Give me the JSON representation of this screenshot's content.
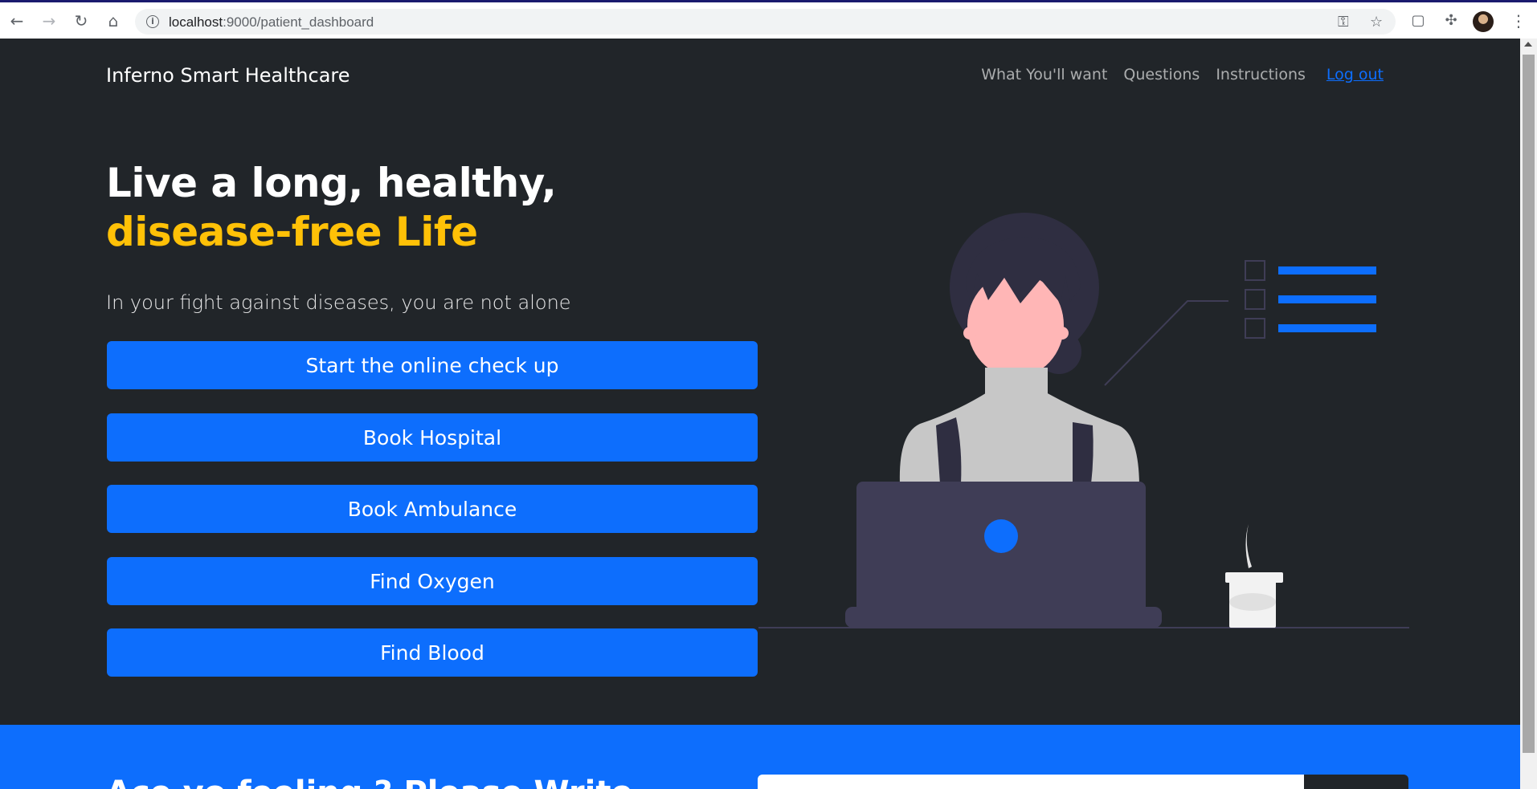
{
  "browser": {
    "url_host": "localhost",
    "url_path": ":9000/patient_dashboard"
  },
  "navbar": {
    "brand": "Inferno Smart Healthcare",
    "links": [
      "What You'll want",
      "Questions",
      "Instructions"
    ],
    "logout": "Log out"
  },
  "hero": {
    "title_plain": "Live a long, healthy, ",
    "title_accent": "disease-free Life",
    "lead": "In your fight against diseases, you are not alone",
    "buttons": [
      "Start the online check up",
      "Book Hospital",
      "Book Ambulance",
      "Find Oxygen",
      "Find Blood"
    ]
  },
  "newsletter": {
    "heading_partial": "Ace yo feeling ? Please Write ..."
  },
  "colors": {
    "background": "#212529",
    "primary": "#0d6efd",
    "accent": "#ffc107"
  }
}
